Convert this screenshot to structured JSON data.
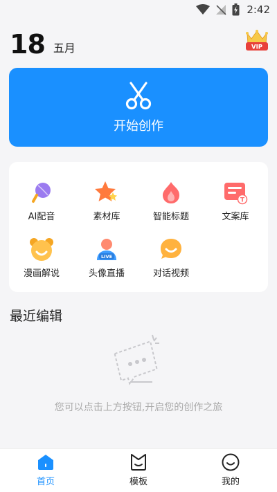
{
  "status_bar": {
    "time": "2:42"
  },
  "header": {
    "day": "18",
    "month": "五月",
    "vip_label": "VIP"
  },
  "create": {
    "label": "开始创作"
  },
  "tools": [
    {
      "label": "AI配音",
      "icon": "microphone-icon"
    },
    {
      "label": "素材库",
      "icon": "star-icon"
    },
    {
      "label": "智能标题",
      "icon": "flame-icon"
    },
    {
      "label": "文案库",
      "icon": "copywriting-icon"
    },
    {
      "label": "漫画解说",
      "icon": "bear-icon"
    },
    {
      "label": "头像直播",
      "icon": "live-avatar-icon"
    },
    {
      "label": "对话视频",
      "icon": "chat-bubble-icon"
    }
  ],
  "recent": {
    "title": "最近编辑",
    "empty_text": "您可以点击上方按钮,开启您的创作之旅"
  },
  "nav": [
    {
      "label": "首页",
      "icon": "home-icon",
      "active": true
    },
    {
      "label": "模板",
      "icon": "template-icon",
      "active": false
    },
    {
      "label": "我的",
      "icon": "profile-icon",
      "active": false
    }
  ],
  "colors": {
    "accent": "#1a90ff",
    "background": "#f5f5f7",
    "vip": "#e8403a"
  }
}
